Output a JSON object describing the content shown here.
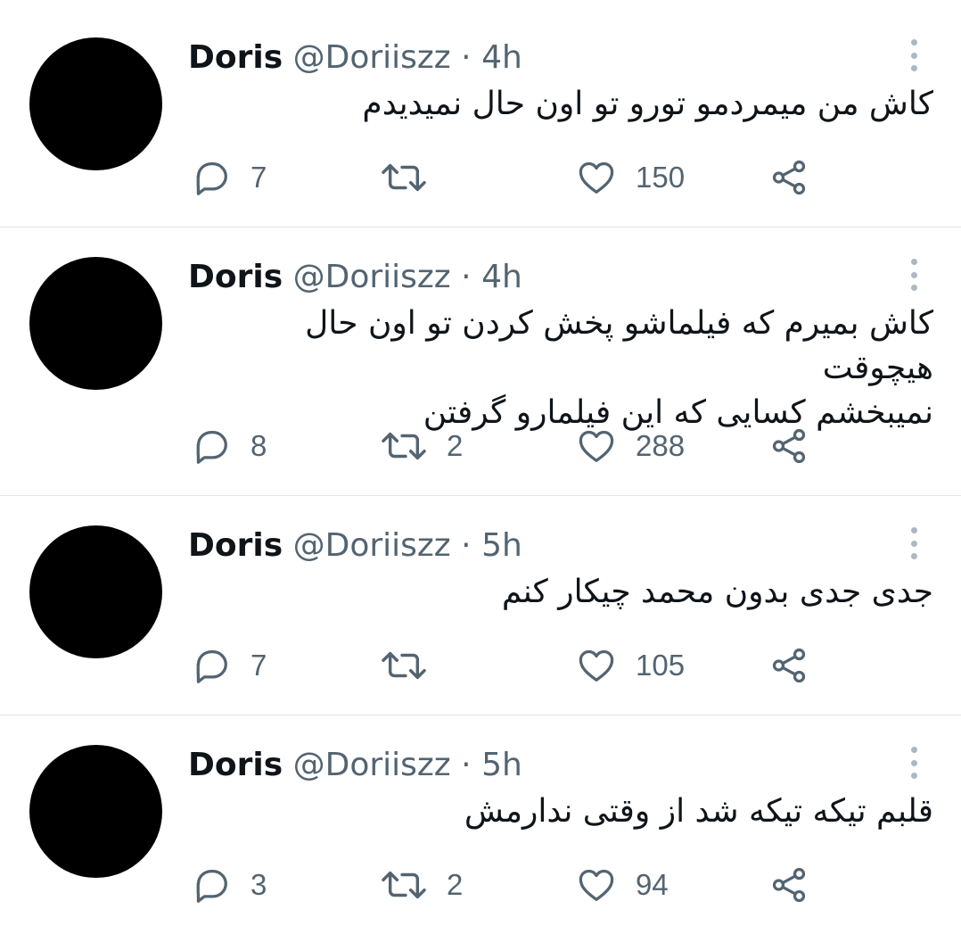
{
  "tweets": [
    {
      "name": "Doris",
      "handle": "@Doriiszz",
      "separator": "·",
      "time": "4h",
      "lines": [
        "کاش من میمردمو تورو تو اون حال نمیدیدم"
      ],
      "replies": "7",
      "retweets": "",
      "likes": "150"
    },
    {
      "name": "Doris",
      "handle": "@Doriiszz",
      "separator": "·",
      "time": "4h",
      "lines": [
        "کاش بمیرم که فیلماشو پخش کردن تو اون حال هیچوقت",
        "نمیبخشم کسایی که این فیلمارو گرفتن"
      ],
      "replies": "8",
      "retweets": "2",
      "likes": "288"
    },
    {
      "name": "Doris",
      "handle": "@Doriiszz",
      "separator": "·",
      "time": "5h",
      "lines": [
        "جدی جدی بدون محمد چیکار کنم"
      ],
      "replies": "7",
      "retweets": "",
      "likes": "105"
    },
    {
      "name": "Doris",
      "handle": "@Doriiszz",
      "separator": "·",
      "time": "5h",
      "lines": [
        "قلبم تیکه تیکه شد از وقتی ندارمش"
      ],
      "replies": "3",
      "retweets": "2",
      "likes": "94"
    }
  ],
  "icons": {
    "reply": "reply-icon",
    "retweet": "retweet-icon",
    "like": "heart-icon",
    "share": "share-icon",
    "more": "more-icon"
  },
  "colors": {
    "text": "#0f1419",
    "secondary": "#536471",
    "divider": "#e1e6ea",
    "avatar": "#000000",
    "more_dots": "#aab8c2"
  }
}
